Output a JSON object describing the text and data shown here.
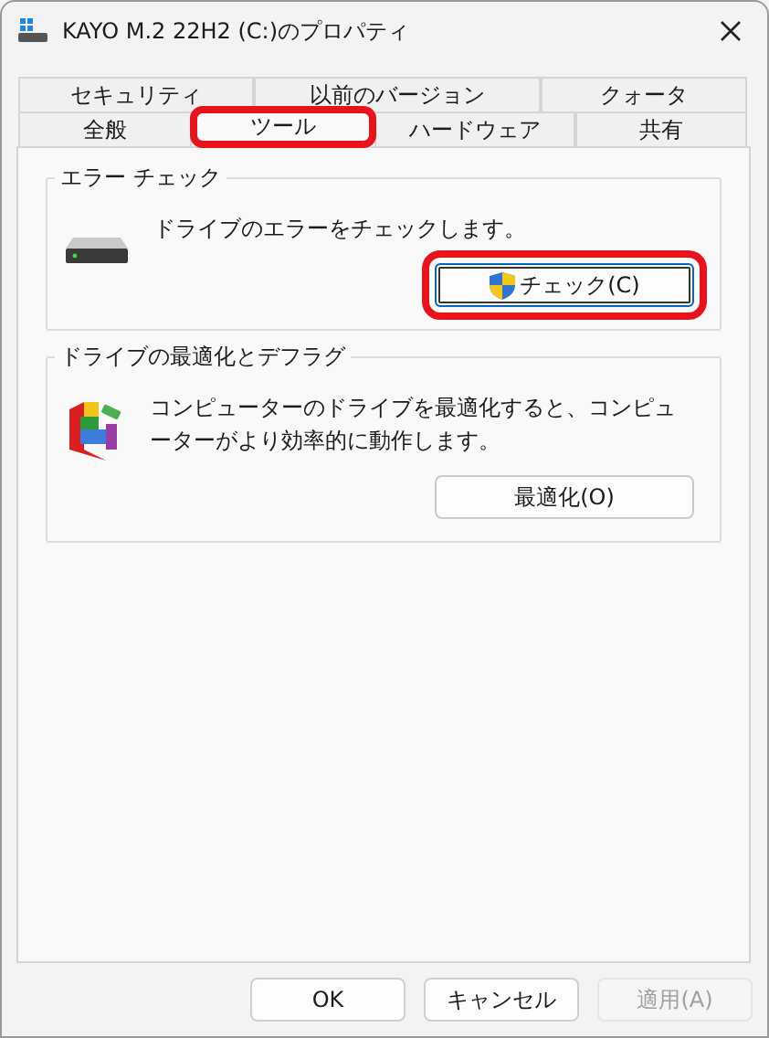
{
  "window": {
    "title": "KAYO M.2 22H2 (C:)のプロパティ"
  },
  "tab_rows": [
    {
      "tabs": [
        {
          "label": "セキュリティ",
          "selected": false,
          "highlighted": false
        },
        {
          "label": "以前のバージョン",
          "selected": false,
          "highlighted": false
        },
        {
          "label": "クォータ",
          "selected": false,
          "highlighted": false
        }
      ]
    },
    {
      "tabs": [
        {
          "label": "全般",
          "selected": false,
          "highlighted": false
        },
        {
          "label": "ツール",
          "selected": true,
          "highlighted": true
        },
        {
          "label": "ハードウェア",
          "selected": false,
          "highlighted": false
        },
        {
          "label": "共有",
          "selected": false,
          "highlighted": false
        }
      ]
    }
  ],
  "groups": [
    {
      "kind": "error_check",
      "title": "エラー チェック",
      "description": "ドライブのエラーをチェックします。",
      "button": {
        "label": "チェック(C)",
        "highlighted": true
      }
    },
    {
      "kind": "defrag",
      "title": "ドライブの最適化とデフラグ",
      "description": "コンピューターのドライブを最適化すると、コンピューターがより効率的に動作します。",
      "button": {
        "label": "最適化(O)",
        "highlighted": false
      }
    }
  ],
  "buttons": [
    {
      "label": "OK",
      "disabled": false
    },
    {
      "label": "キャンセル",
      "disabled": false
    },
    {
      "label": "適用(A)",
      "disabled": true
    }
  ]
}
